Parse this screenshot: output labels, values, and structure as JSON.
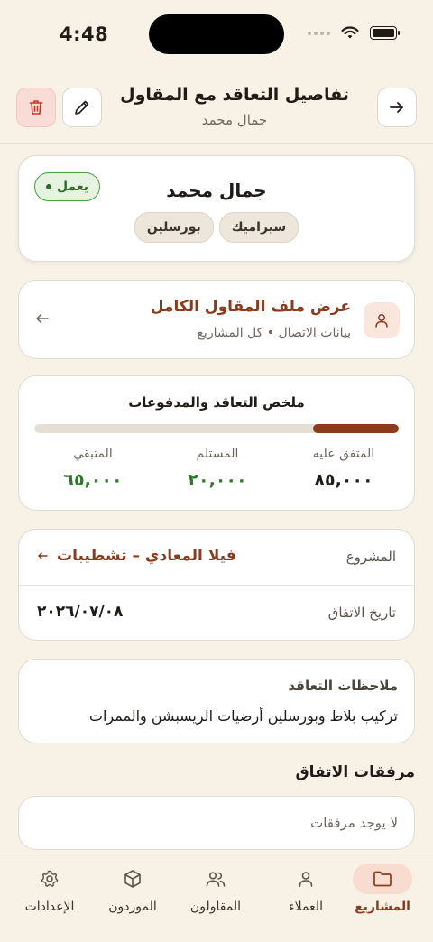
{
  "status_bar": {
    "time": "4:48"
  },
  "header": {
    "title": "تفاصيل التعاقد مع المقاول",
    "subtitle": "جمال محمد"
  },
  "profile": {
    "name": "جمال محمد",
    "status": "يعمل",
    "tags": [
      "سيراميك",
      "بورسلين"
    ]
  },
  "profile_link": {
    "title": "عرض ملف المقاول الكامل",
    "subtitle": "بيانات الاتصال • كل المشاريع"
  },
  "summary": {
    "title": "ملخص التعاقد والمدفوعات",
    "paid_fraction": 0.235,
    "agreed_label": "المتفق عليه",
    "agreed_value": "٨٥,٠٠٠",
    "received_label": "المستلم",
    "received_value": "٢٠,٠٠٠",
    "remaining_label": "المتبقي",
    "remaining_value": "٦٥,٠٠٠",
    "colors": {
      "paid": "#8b3a1b",
      "track": "#e4dfd2",
      "positive": "#2d7a2a"
    }
  },
  "info": {
    "project_label": "المشروع",
    "project_value": "فيلا المعادي – تشطيبات",
    "date_label": "تاريخ الاتفاق",
    "date_value": "٢٠٢٦/٠٧/٠٨"
  },
  "notes": {
    "title": "ملاحظات التعاقد",
    "text": "تركيب بلاط وبورسلين أرضيات الريسبشن والممرات"
  },
  "attachments": {
    "heading": "مرفقات الاتفاق",
    "empty": "لا يوجد مرفقات"
  },
  "tabs": [
    {
      "label": "المشاريع",
      "icon": "folder-icon",
      "active": true
    },
    {
      "label": "العملاء",
      "icon": "person-icon",
      "active": false
    },
    {
      "label": "المقاولون",
      "icon": "people-icon",
      "active": false
    },
    {
      "label": "الموردون",
      "icon": "cube-icon",
      "active": false
    },
    {
      "label": "الإعدادات",
      "icon": "gear-icon",
      "active": false
    }
  ],
  "theme": {
    "accent": "#8b3a1b",
    "background": "#f7f1e6",
    "danger": "#c0392b",
    "success": "#2d7a2a"
  }
}
